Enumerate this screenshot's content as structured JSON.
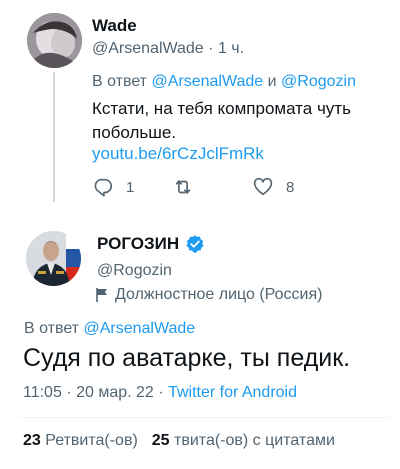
{
  "parent_tweet": {
    "author_name": "Wade",
    "author_handle": "@ArsenalWade",
    "separator": "·",
    "age": "1 ч.",
    "reply_prefix": "В ответ",
    "reply_to_1": "@ArsenalWade",
    "reply_conj": "и",
    "reply_to_2": "@Rogozin",
    "text": "Кстати, на тебя компромата чуть побольше.",
    "link": "youtu.be/6rCzJclFmRk",
    "replies": "1",
    "likes": "8"
  },
  "main_tweet": {
    "author_name": "РОГОЗИН",
    "author_handle": "@Rogozin",
    "account_label": "Должностное лицо (Россия)",
    "reply_prefix": "В ответ",
    "reply_to": "@ArsenalWade",
    "text": "Судя по аватарке, ты педик.",
    "time": "11:05",
    "date": "20 мар. 22",
    "separator": "·",
    "source": "Twitter for Android",
    "retweets_count": "23",
    "retweets_label": "Ретвита(-ов)",
    "quotes_count": "25",
    "quotes_label": "твита(-ов) с цитатами"
  },
  "icons": {
    "reply": "reply-icon",
    "retweet": "retweet-icon",
    "like": "heart-icon",
    "verified": "verified-badge-icon",
    "flag": "flag-icon"
  },
  "colors": {
    "link": "#1d9bf0",
    "secondary_text": "#536471",
    "primary_text": "#0f1419",
    "divider": "#eff3f4"
  }
}
